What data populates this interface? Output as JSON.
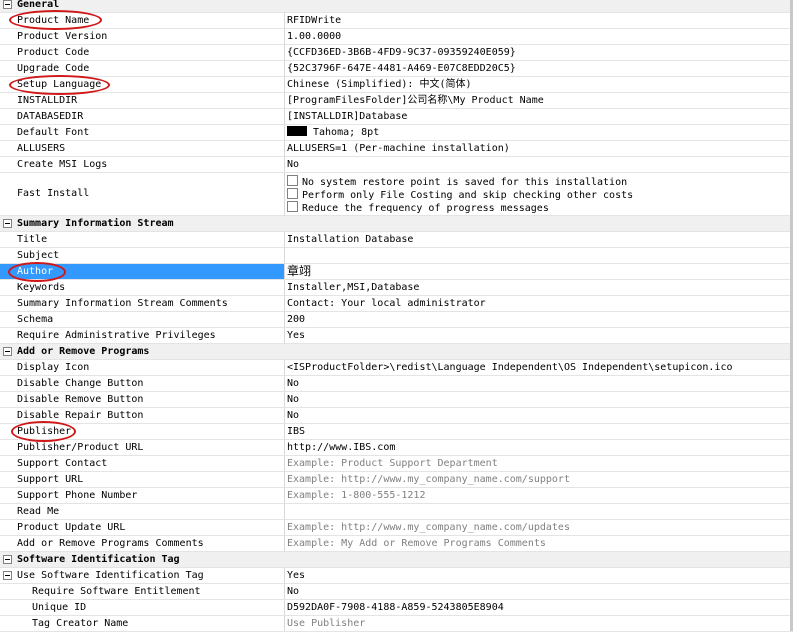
{
  "sections": {
    "general": "General",
    "summary": "Summary Information Stream",
    "add_remove": "Add or Remove Programs",
    "swid": "Software Identification Tag"
  },
  "general": {
    "product_name": {
      "name": "Product Name",
      "value": "RFIDWrite"
    },
    "product_version": {
      "name": "Product Version",
      "value": "1.00.0000"
    },
    "product_code": {
      "name": "Product Code",
      "value": "{CCFD36ED-3B6B-4FD9-9C37-09359240E059}"
    },
    "upgrade_code": {
      "name": "Upgrade Code",
      "value": "{52C3796F-647E-4481-A469-E07C8EDD20C5}"
    },
    "setup_language": {
      "name": "Setup Language",
      "value": "Chinese (Simplified): 中文(简体)"
    },
    "installdir": {
      "name": "INSTALLDIR",
      "value": "[ProgramFilesFolder]公司名称\\My Product Name"
    },
    "databasedir": {
      "name": "DATABASEDIR",
      "value": "[INSTALLDIR]Database"
    },
    "default_font": {
      "name": "Default Font",
      "value": "Tahoma; 8pt"
    },
    "allusers": {
      "name": "ALLUSERS",
      "value": "ALLUSERS=1 (Per-machine installation)"
    },
    "create_msi_logs": {
      "name": "Create MSI Logs",
      "value": "No"
    },
    "fast_install": {
      "name": "Fast Install",
      "options": [
        "No system restore point is saved for this installation",
        "Perform only File Costing and skip checking other costs",
        "Reduce the frequency of progress messages"
      ]
    }
  },
  "summary": {
    "title": {
      "name": "Title",
      "value": "Installation Database"
    },
    "subject": {
      "name": "Subject",
      "value": ""
    },
    "author": {
      "name": "Author",
      "value": "章翊"
    },
    "keywords": {
      "name": "Keywords",
      "value": "Installer,MSI,Database"
    },
    "comments": {
      "name": "Summary Information Stream Comments",
      "value": "Contact:  Your local administrator"
    },
    "schema": {
      "name": "Schema",
      "value": "200"
    },
    "admin": {
      "name": "Require Administrative Privileges",
      "value": "Yes"
    }
  },
  "add_remove": {
    "display_icon": {
      "name": "Display Icon",
      "value": "<ISProductFolder>\\redist\\Language Independent\\OS Independent\\setupicon.ico"
    },
    "disable_change": {
      "name": "Disable Change Button",
      "value": "No"
    },
    "disable_remove": {
      "name": "Disable Remove Button",
      "value": "No"
    },
    "disable_repair": {
      "name": "Disable Repair Button",
      "value": "No"
    },
    "publisher": {
      "name": "Publisher",
      "value": "IBS"
    },
    "publisher_url": {
      "name": "Publisher/Product URL",
      "value": "http://www.IBS.com"
    },
    "support_contact": {
      "name": "Support Contact",
      "value": "Example: Product Support Department"
    },
    "support_url": {
      "name": "Support URL",
      "value": "Example: http://www.my_company_name.com/support"
    },
    "support_phone": {
      "name": "Support Phone Number",
      "value": "Example: 1-800-555-1212"
    },
    "read_me": {
      "name": "Read Me",
      "value": ""
    },
    "update_url": {
      "name": "Product Update URL",
      "value": "Example: http://www.my_company_name.com/updates"
    },
    "arp_comments": {
      "name": "Add or Remove Programs Comments",
      "value": "Example: My Add or Remove Programs Comments"
    }
  },
  "swid": {
    "use_tag": {
      "name": "Use Software Identification Tag",
      "value": "Yes"
    },
    "entitlement": {
      "name": "Require Software Entitlement",
      "value": "No"
    },
    "unique_id": {
      "name": "Unique ID",
      "value": "D592DA0F-7908-4188-A859-5243805E8904"
    },
    "tag_creator": {
      "name": "Tag Creator Name",
      "value": "Use Publisher"
    }
  },
  "colors": {
    "selection": "#3399ff",
    "annotation": "#d01818",
    "section_bg": "#f0f0f0",
    "hint_text": "#808080"
  }
}
